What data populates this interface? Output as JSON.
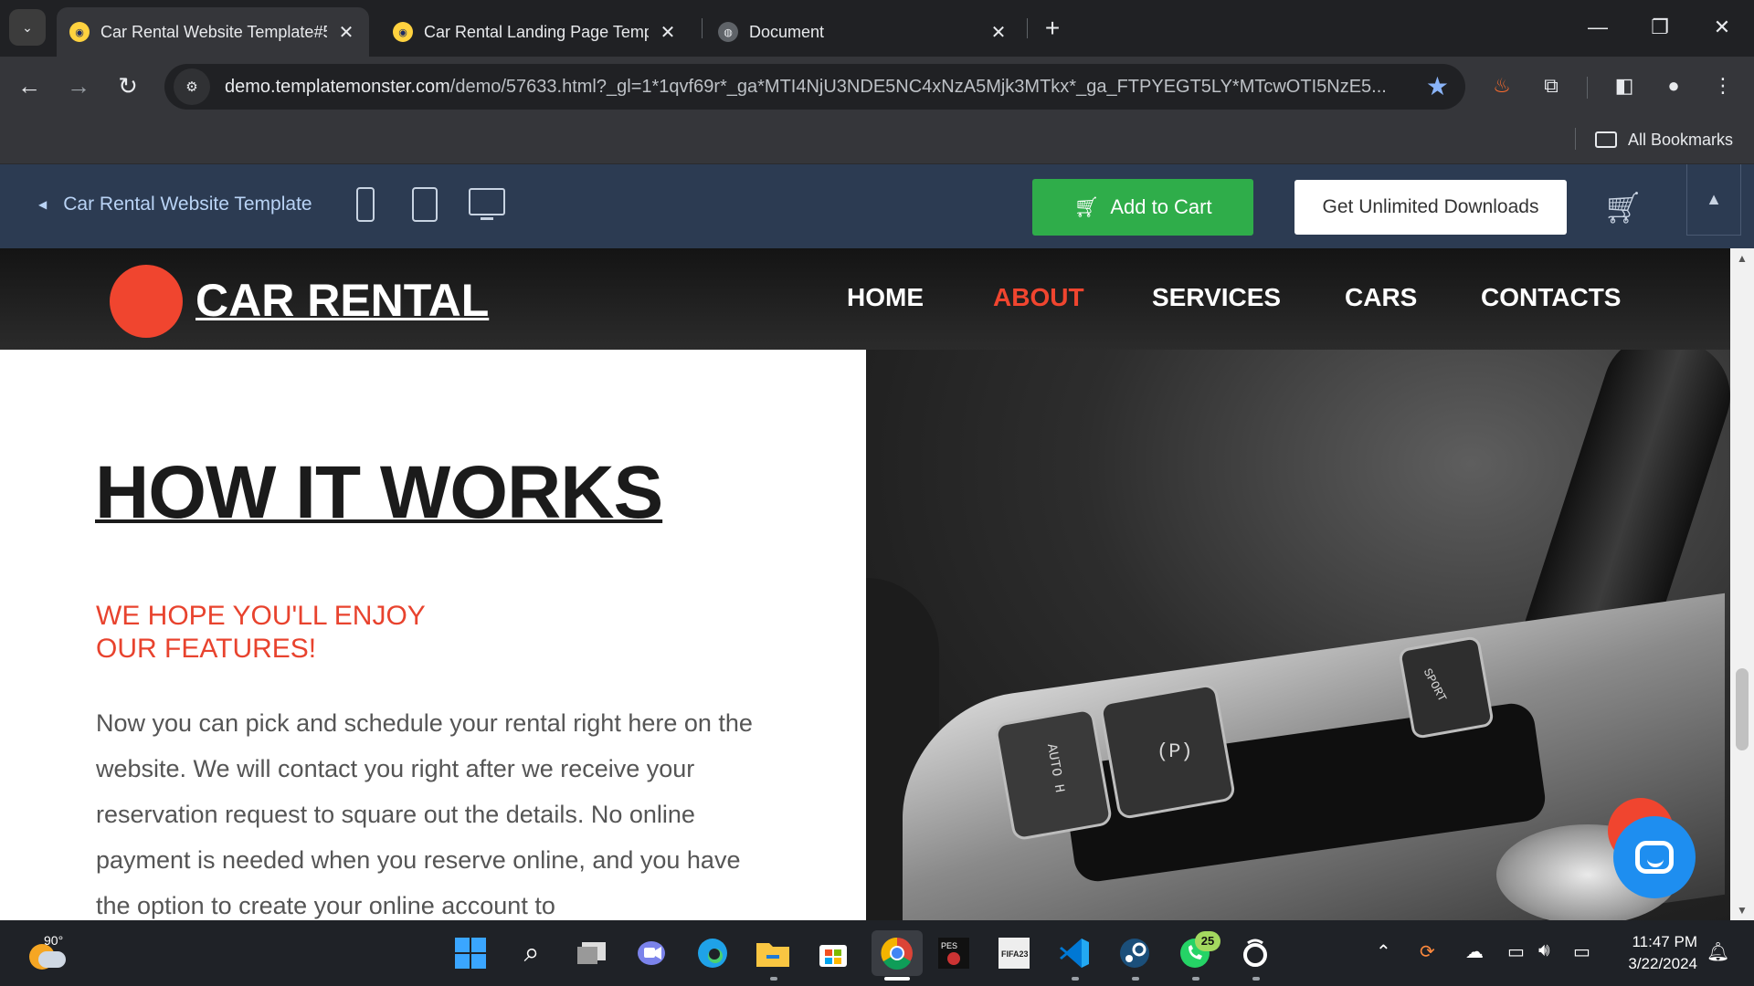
{
  "browser": {
    "tabs": [
      {
        "title": "Car Rental Website Template#5",
        "active": true
      },
      {
        "title": "Car Rental Landing Page Templa",
        "active": false
      },
      {
        "title": "Document",
        "active": false
      }
    ],
    "url_host": "demo.templatemonster.com",
    "url_rest": "/demo/57633.html?_gl=1*1qvf69r*_ga*MTI4NjU3NDE5NC4xNzA5Mjk3MTkx*_ga_FTPYEGT5LY*MTcwOTI5NzE5...",
    "bookmarks_label": "All Bookmarks",
    "accent_color": "#8ab4f8"
  },
  "demo_bar": {
    "back_label": "Car Rental Website Template",
    "add_to_cart": "Add to Cart",
    "unlimited": "Get Unlimited Downloads",
    "cart_color": "#2fad4a"
  },
  "site": {
    "logo": "CAR RENTAL",
    "nav": [
      "HOME",
      "ABOUT",
      "SERVICES",
      "CARS",
      "CONTACTS"
    ],
    "active_nav": "ABOUT",
    "heading": "HOW IT WORKS",
    "subheading_line1": "WE HOPE YOU'LL ENJOY",
    "subheading_line2": "OUR FEATURES!",
    "body": "Now you can pick and schedule your rental right here on the website. We will contact you right after we receive your reservation request to square out the details. No online payment is needed when you reserve online, and you have the option to create your online account to",
    "image_labels": {
      "autoh": "AUTO H",
      "park": "(P)",
      "sport": "SPORT"
    },
    "accent_color": "#f0452f"
  },
  "taskbar": {
    "temperature": "90°",
    "whatsapp_badge": "25",
    "time": "11:47 PM",
    "date": "3/22/2024"
  }
}
